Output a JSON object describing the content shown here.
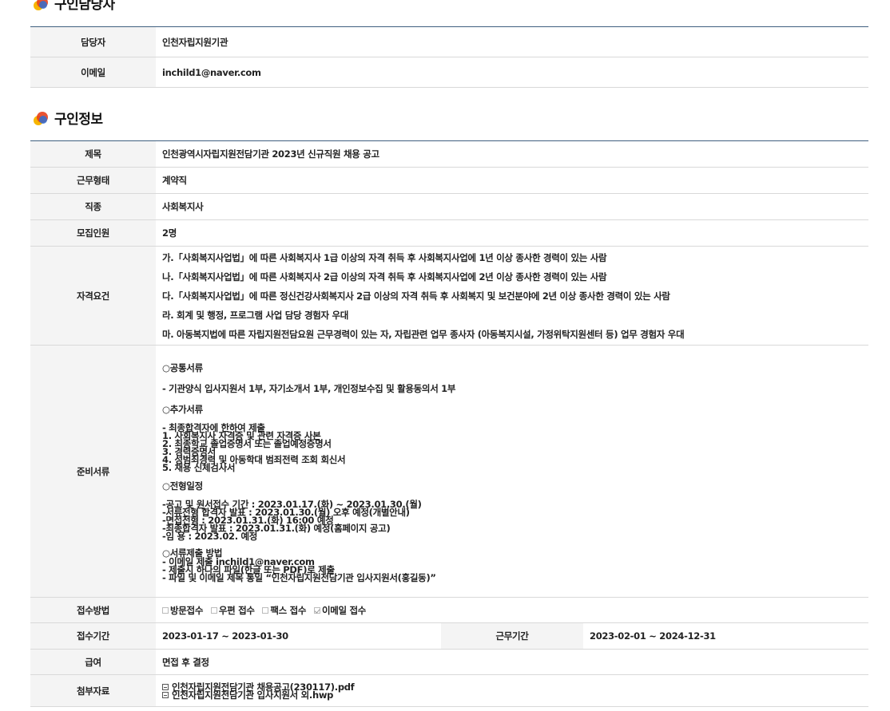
{
  "contact_section": {
    "title": "구인담당자",
    "rows": [
      {
        "label": "담당자",
        "value": "인천자립지원기관"
      },
      {
        "label": "이메일",
        "value": "inchild1@naver.com"
      }
    ]
  },
  "job_section": {
    "title": "구인정보",
    "title_row": {
      "label": "제목",
      "value": "인천광역시자립지원전담기관 2023년 신규직원 채용 공고"
    },
    "employment_type": {
      "label": "근무형태",
      "value": "계약직"
    },
    "occupation": {
      "label": "직종",
      "value": "사회복지사"
    },
    "headcount": {
      "label": "모집인원",
      "value": "2명"
    },
    "qualifications": {
      "label": "자격요건",
      "items": [
        "가.「사회복지사업법」에 따른 사회복지사 1급 이상의 자격 취득 후 사회복지사업에 1년 이상 종사한 경력이 있는 사람",
        "나.「사회복지사업법」에 따른 사회복지사 2급 이상의 자격 취득 후 사회복지사업에 2년 이상 종사한 경력이 있는 사람",
        "다.「사회복지사업법」에 따른 정신건강사회복지사 2급 이상의 자격 취득 후 사회복지 및 보건분야에 2년 이상 종사한 경력이 있는 사람",
        "라. 회계 및 행정, 프로그램 사업 담당 경험자 우대",
        "마. 아동복지법에 따른 자립지원전담요원 근무경력이 있는 자, 자립관련 업무 종사자 (아동복지시설, 가정위탁지원센터 등) 업무 경험자 우대"
      ]
    },
    "documents": {
      "label": "준비서류",
      "common_heading": "○공통서류",
      "common_text": "- 기관양식 입사지원서 1부, 자기소개서 1부, 개인정보수집 및 활용동의서 1부",
      "extra_heading": "○추가서류",
      "extra_lines": [
        "- 최종합격자에 한하여 제출",
        "1. 사회복지사 자격증 및 관련 자격증 사본",
        "2. 최종학교 졸업증명서 또는 졸업예정증명서",
        "3. 경력증명서",
        "4. 성범죄경력 및 아동학대 범죄전력 조회 회신서",
        "5. 채용 신체검사서"
      ],
      "schedule_heading": "○전형일정",
      "schedule_lines": [
        "-공고 및 원서접수 기간 : 2023.01.17.(화) ~ 2023.01.30.(월)",
        "-서류전형 합격자 발표 : 2023.01.30.(월) 오후 예정(개별안내)",
        "-면접전형 : 2023.01.31.(화) 16:00 예정",
        "-최종합격자 발표 : 2023.01.31.(화) 예정(홈페이지 공고)",
        "-임 용 : 2023.02. 예정"
      ],
      "submit_heading": "○서류제출 방법",
      "submit_lines": [
        " - 이메일 제출 inchild1@naver.com",
        " - 제출시 하나의 파일(한글 또는 PDF)로 제출",
        " - 파일 및 이메일 제목 통일 “인천자립지원전담기관 입사지원서(홍길동)”"
      ]
    },
    "receipt_method": {
      "label": "접수방법",
      "options": [
        {
          "text": "방문접수",
          "checked": false
        },
        {
          "text": "우편 접수",
          "checked": false
        },
        {
          "text": "팩스 접수",
          "checked": false
        },
        {
          "text": "이메일 접수",
          "checked": true
        }
      ]
    },
    "receipt_period": {
      "label": "접수기간",
      "value": "2023-01-17 ~ 2023-01-30"
    },
    "work_period": {
      "label": "근무기간",
      "value": "2023-02-01 ~ 2024-12-31"
    },
    "salary": {
      "label": "급여",
      "value": "면접 후 결정"
    },
    "attachments": {
      "label": "첨부자료",
      "files": [
        "인천자립지원전담기관 채용공고(230117).pdf",
        "인천자립지원전담기관 입사지원서 외.hwp"
      ]
    }
  }
}
